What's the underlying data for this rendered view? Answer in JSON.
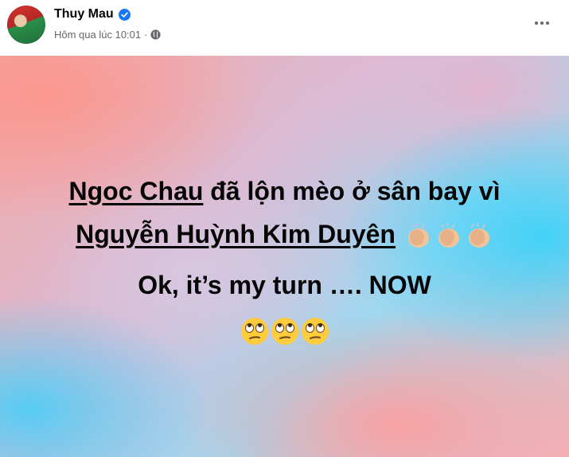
{
  "post": {
    "author": "Thuy Mau",
    "timestamp": "Hôm qua lúc 10:01",
    "separator": "·",
    "privacy_icon": "globe-icon",
    "verified_icon": "verified-badge-icon",
    "more_icon": "more-options-icon"
  },
  "content": {
    "mention1": "Ngoc Chau",
    "line1_rest": " đã lộn mèo ở sân bay vì",
    "mention2": "Nguyễn Huỳnh Kim Duyên",
    "line2_emojis": "clapping-hands-emoji x3",
    "line3": "Ok, it’s my turn …. NOW",
    "line4_emojis": "face-with-rolling-eyes-emoji x3"
  },
  "colors": {
    "text": "#050505",
    "meta": "#65676b",
    "verified": "#1877f2"
  }
}
